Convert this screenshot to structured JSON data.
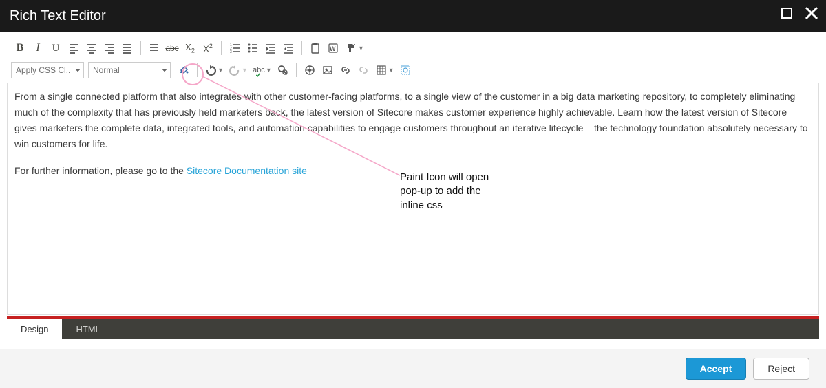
{
  "window": {
    "title": "Rich Text Editor"
  },
  "toolbar": {
    "css_select": "Apply CSS Cl...",
    "format_select": "Normal"
  },
  "content": {
    "paragraph1": "From a single connected platform that also integrates with other customer-facing platforms, to a single view of the customer in a big data marketing repository, to completely eliminating much of the complexity that has previously held marketers back, the latest version of Sitecore makes customer experience highly achievable. Learn how the latest version of Sitecore gives marketers the complete data, integrated tools, and automation capabilities to engage customers throughout an iterative lifecycle – the technology foundation absolutely necessary to win customers for life.",
    "paragraph2a": "For further information, please go to the ",
    "link_text": "Sitecore Documentation site"
  },
  "annotation": {
    "line1": "Paint Icon will open",
    "line2": "pop-up to add the",
    "line3": "inline css"
  },
  "tabs": {
    "design": "Design",
    "html": "HTML"
  },
  "footer": {
    "accept": "Accept",
    "reject": "Reject"
  }
}
